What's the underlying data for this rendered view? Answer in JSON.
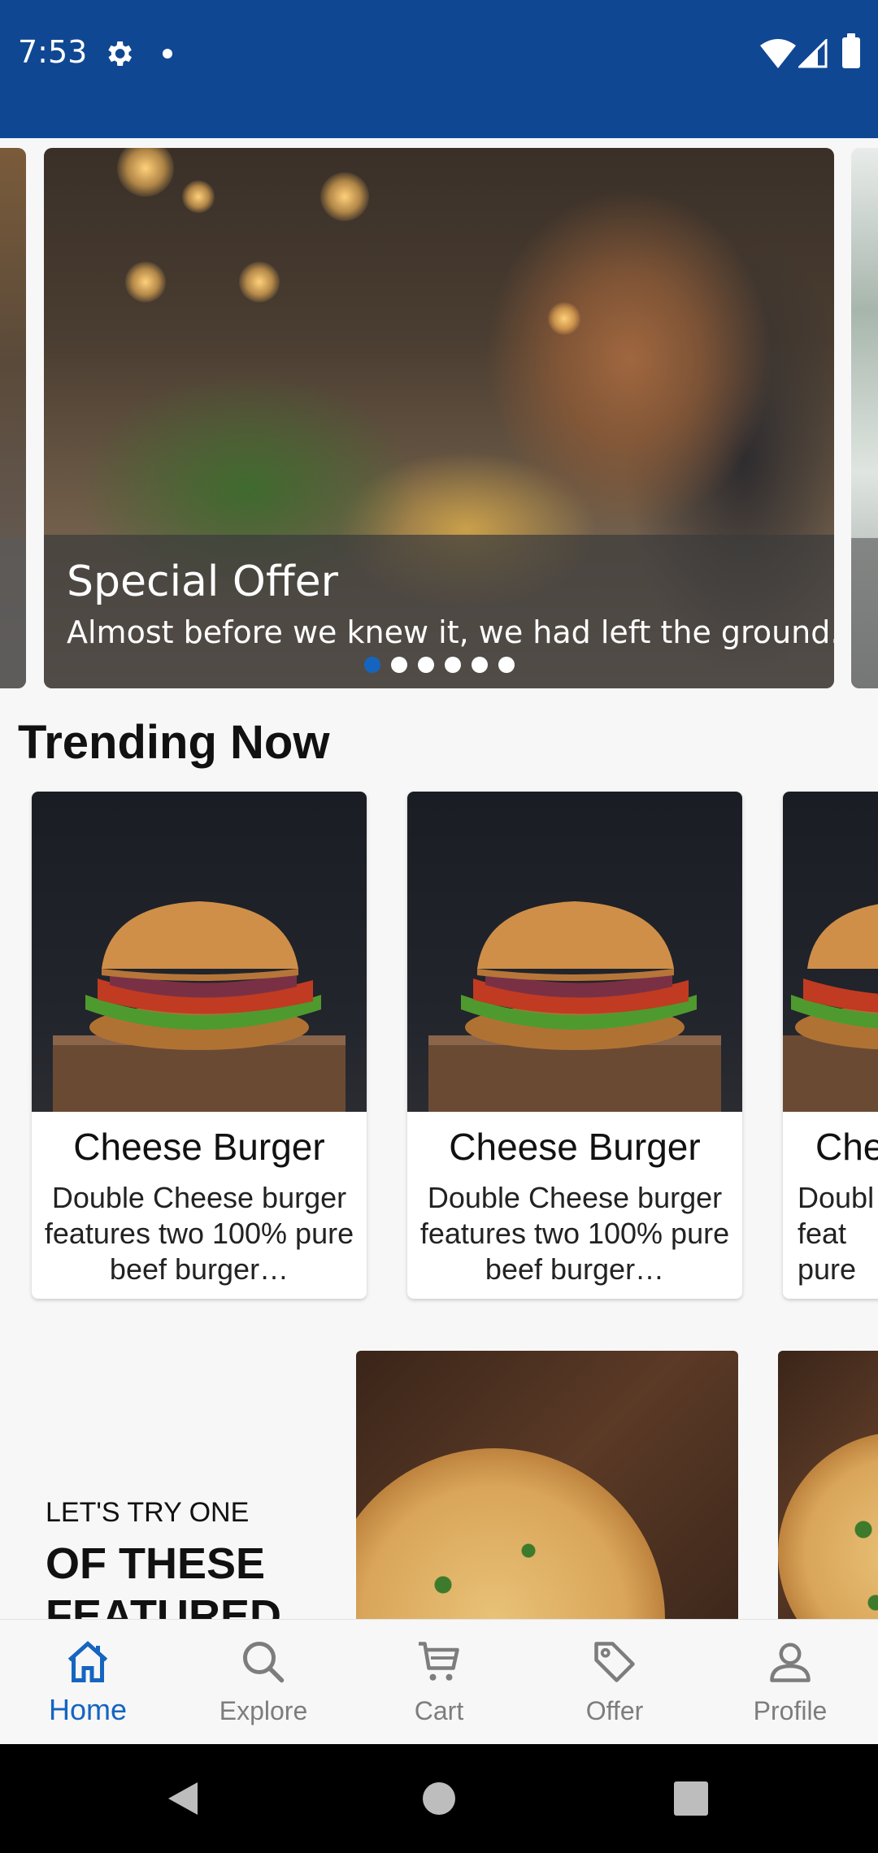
{
  "status_bar": {
    "time": "7:53"
  },
  "carousel": {
    "title": "Special Offer",
    "text": "Almost before we knew it, we had left the ground.",
    "dot_count": 6,
    "active_dot": 0
  },
  "trending": {
    "title": "Trending Now",
    "cards": [
      {
        "title": "Cheese Burger",
        "desc": "Double Cheese burger features two 100% pure beef burger…"
      },
      {
        "title": "Cheese Burger",
        "desc": "Double Cheese burger features two 100% pure beef burger…"
      },
      {
        "title": "Che",
        "desc": "Doubl feat pure"
      }
    ]
  },
  "featured": {
    "line1": "LET'S TRY ONE",
    "line2": "OF THESE FEATURED"
  },
  "bottom_nav": {
    "items": [
      {
        "label": "Home",
        "icon": "home-icon",
        "active": true
      },
      {
        "label": "Explore",
        "icon": "search-icon",
        "active": false
      },
      {
        "label": "Cart",
        "icon": "cart-icon",
        "active": false
      },
      {
        "label": "Offer",
        "icon": "tag-icon",
        "active": false
      },
      {
        "label": "Profile",
        "icon": "person-icon",
        "active": false
      }
    ]
  },
  "colors": {
    "primary": "#0f4793",
    "accent": "#1565c0",
    "inactive": "#7d7d7d"
  }
}
